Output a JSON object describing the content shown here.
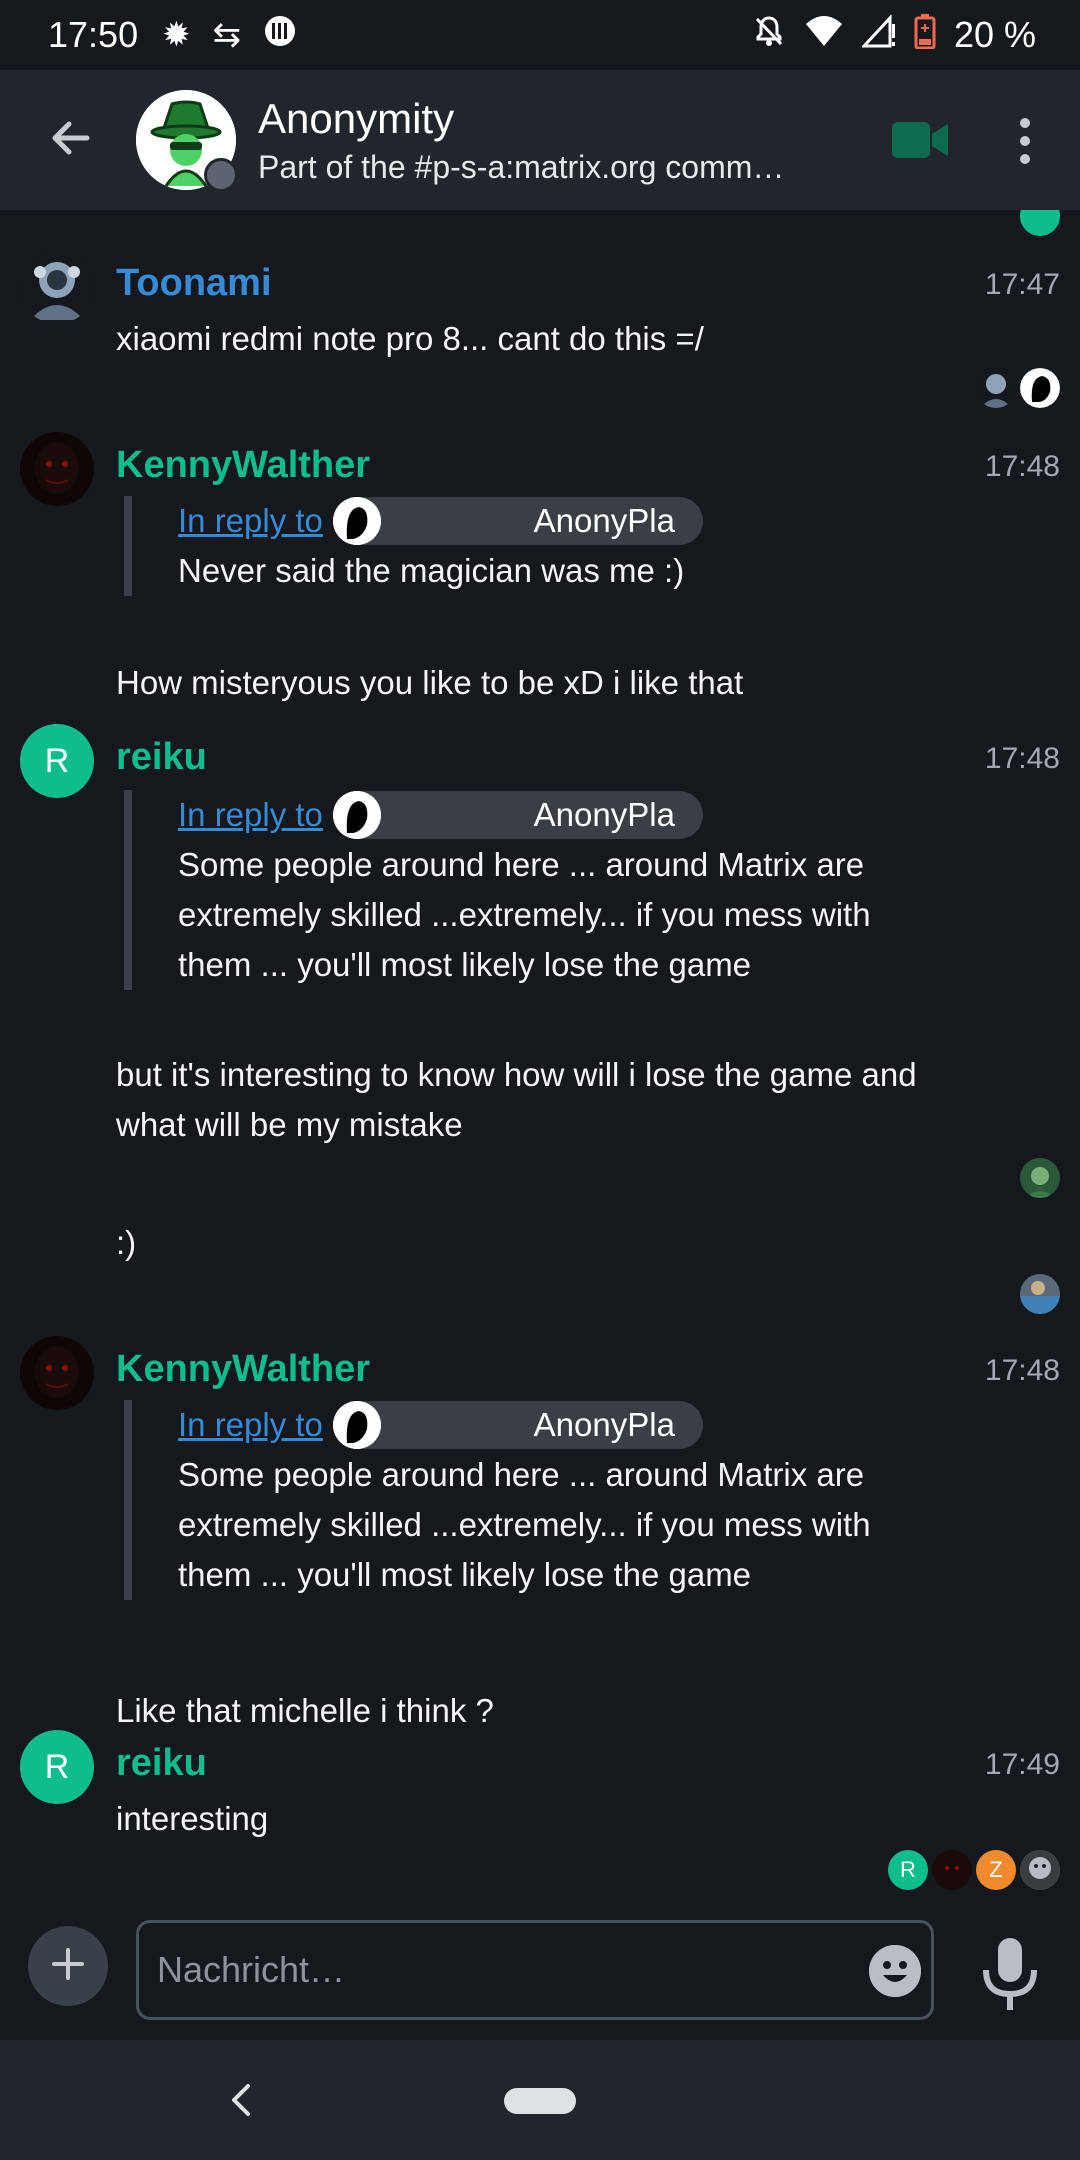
{
  "status_bar": {
    "time": "17:50",
    "battery_text": "20 %"
  },
  "header": {
    "room_name": "Anonymity",
    "room_topic": "Part of the #p-s-a:matrix.org comm…"
  },
  "colors": {
    "accent": "#0dbd8b",
    "link": "#368bd6",
    "toonami": "#368bd6",
    "green_sender": "#0dbd8b",
    "background": "#15191e",
    "header_bg": "#21262c"
  },
  "messages": [
    {
      "sender": "Toonami",
      "time": "17:47",
      "text": "xiaomi redmi note pro 8... cant do this =/"
    },
    {
      "sender": "KennyWalther",
      "time": "17:48",
      "reply_link": "In reply to",
      "reply_user": "AnonyPla",
      "reply_text": "Never said the magician was me :)",
      "text": "How misteryous you like to be xD i like that"
    },
    {
      "sender": "reiku",
      "avatar_letter": "R",
      "time": "17:48",
      "reply_link": "In reply to",
      "reply_user": "AnonyPla",
      "reply_text": "Some people around here ... around Matrix are extremely skilled ...extremely... if you mess with them ... you'll most likely lose the game",
      "text": "but it's interesting to know how will i lose the game and what will be my mistake",
      "text2": ":)"
    },
    {
      "sender": "KennyWalther",
      "time": "17:48",
      "reply_link": "In reply to",
      "reply_user": "AnonyPla",
      "reply_text": "Some people around here ... around Matrix are extremely skilled ...extremely... if you mess with them ... you'll most likely lose the game",
      "text": "Like that michelle i think ?"
    },
    {
      "sender": "reiku",
      "avatar_letter": "R",
      "time": "17:49",
      "text": "interesting"
    }
  ],
  "read_receipts": {
    "final": [
      {
        "letter": "R",
        "color": "#0dbd8b"
      },
      {
        "letter": "",
        "color": "#1a0a0a"
      },
      {
        "letter": "Z",
        "color": "#f08a2c"
      },
      {
        "letter": "",
        "color": "#6d7075"
      }
    ]
  },
  "composer": {
    "placeholder": "Nachricht…"
  },
  "icons": {
    "back": "arrow-left-icon",
    "video": "video-call-icon",
    "menu": "more-vertical-icon",
    "attach": "plus-icon",
    "emoji": "emoji-icon",
    "mic": "microphone-icon"
  }
}
